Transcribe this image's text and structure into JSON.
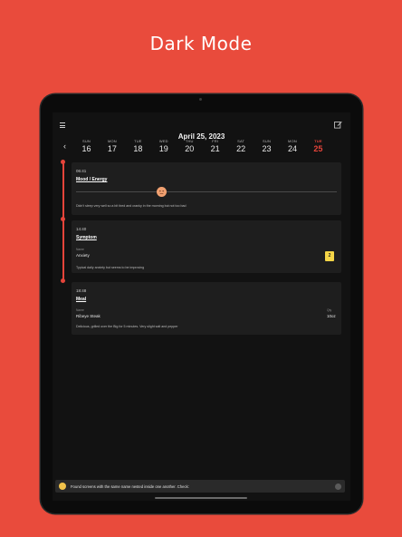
{
  "headline": "Dark Mode",
  "header": {
    "date_title": "April 25, 2023"
  },
  "days": [
    {
      "name": "SUN",
      "num": "16"
    },
    {
      "name": "MON",
      "num": "17"
    },
    {
      "name": "TUE",
      "num": "18"
    },
    {
      "name": "WED",
      "num": "19"
    },
    {
      "name": "THU",
      "num": "20"
    },
    {
      "name": "FRI",
      "num": "21"
    },
    {
      "name": "SAT",
      "num": "22"
    },
    {
      "name": "SUN",
      "num": "23"
    },
    {
      "name": "MON",
      "num": "24"
    },
    {
      "name": "TUE",
      "num": "25"
    }
  ],
  "entries": {
    "mood": {
      "time": "06:41",
      "title": "Mood / Energy",
      "note": "Didn't sleep very well so a bit tired and cranky in the morning but not too bad"
    },
    "symptom": {
      "time": "14:40",
      "title": "Symptom",
      "label": "Name",
      "value": "Anxiety",
      "badge": "2",
      "note": "Typical daily anxiety but seems to be improving"
    },
    "meal": {
      "time": "18:48",
      "title": "Meal",
      "label": "Name",
      "value": "Ribeye Steak",
      "qty_label": "Qty",
      "qty_value": "10oz",
      "note": "Delicious, grilled over the Big for 5 minutes. Very slight salt and pepper"
    }
  },
  "snackbar": {
    "text": "Found screens with the same name nested inside one another. Check:"
  },
  "colors": {
    "accent": "#e5443a",
    "background": "#e94b3c",
    "badge": "#f5d547"
  }
}
